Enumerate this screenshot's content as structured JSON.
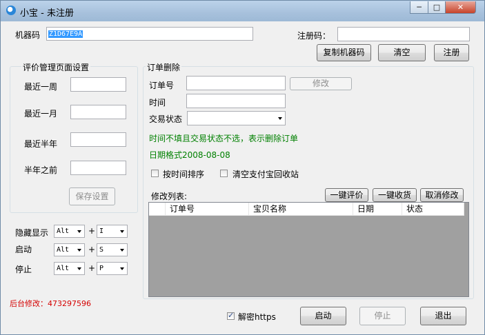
{
  "window": {
    "title": "小宝  - 未注册",
    "minimize": "─",
    "maximize": "□",
    "close": "✕"
  },
  "reg": {
    "machine_label": "机器码",
    "machine_value": "Z1D67E9A",
    "regcode_label": "注册码：",
    "regcode_value": "",
    "copy_button": "复制机器码",
    "clear_button": "清空",
    "register_button": "注册"
  },
  "review": {
    "title": "评价管理页面设置",
    "rows": [
      {
        "label": "最近一周",
        "value": ""
      },
      {
        "label": "最近一月",
        "value": ""
      },
      {
        "label": "最近半年",
        "value": ""
      },
      {
        "label": "半年之前",
        "value": ""
      }
    ],
    "save_button": "保存设置"
  },
  "hotkeys": [
    {
      "label": "隐藏显示",
      "mod": "Alt",
      "plus": "+",
      "key": "I"
    },
    {
      "label": "启动",
      "mod": "Alt",
      "plus": "+",
      "key": "S"
    },
    {
      "label": "停止",
      "mod": "Alt",
      "plus": "+",
      "key": "P"
    }
  ],
  "footer_note": "后台修改：473297596",
  "order": {
    "title": "订单删除",
    "order_no_label": "订单号",
    "order_no_value": "",
    "modify_button": "修改",
    "time_label": "时间",
    "time_value": "",
    "status_label": "交易状态",
    "status_value": "",
    "hint1": "时间不填且交易状态不选，表示删除订单",
    "hint2": "日期格式2008-08-08",
    "sort_by_time": "按时间排序",
    "sort_checked": false,
    "clear_alipay": "清空支付宝回收站",
    "clear_checked": false
  },
  "modify_list": {
    "label": "修改列表:",
    "btn_review": "一键评价",
    "btn_receive": "一键收货",
    "btn_cancel": "取消修改",
    "columns": [
      "订单号",
      "宝贝名称",
      "日期",
      "状态"
    ],
    "rows": []
  },
  "bottom": {
    "decrypt_https": "解密https",
    "decrypt_checked": true,
    "start_button": "启动",
    "stop_button": "停止",
    "exit_button": "退出"
  }
}
